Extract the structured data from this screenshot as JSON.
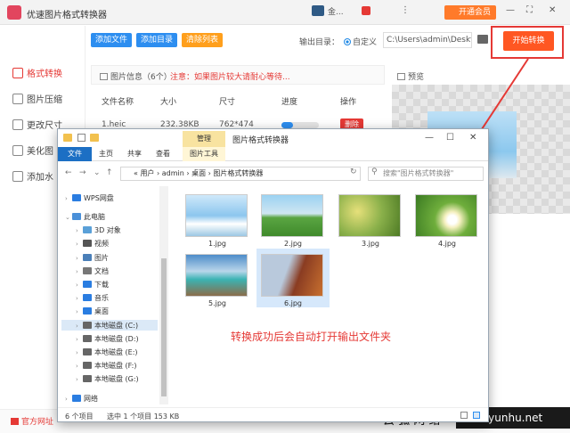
{
  "app": {
    "title": "优速图片格式转换器",
    "user": "金...",
    "vip_label": "开通会员",
    "controls": [
      "⋮",
      "—",
      "⛶",
      "✕"
    ]
  },
  "sidebar": {
    "items": [
      {
        "label": "格式转换",
        "active": true
      },
      {
        "label": "图片压缩"
      },
      {
        "label": "更改尺寸"
      },
      {
        "label": "美化图"
      },
      {
        "label": "添加水"
      }
    ]
  },
  "toolbar": {
    "add_file": "添加文件",
    "add_dir": "添加目录",
    "clear_list": "清除列表",
    "output_label": "输出目录：",
    "radio_label": "自定义",
    "output_path": "C:\\Users\\admin\\Deskto",
    "start_label": "开始转换"
  },
  "file_panel": {
    "info": "图片信息（6个）",
    "warning": "注意：如果图片较大请耐心等待...",
    "columns": [
      "文件名称",
      "大小",
      "尺寸",
      "进度",
      "操作"
    ],
    "row": {
      "name": "1.heic",
      "size": "232.38KB",
      "dims": "762*474",
      "progress": 0.3,
      "delete_label": "删除"
    }
  },
  "preview": {
    "label": "预览"
  },
  "footer": {
    "official": "官方网址",
    "watermark_cn": "云 狐 网 络",
    "watermark_url": "www.yunhu.net"
  },
  "explorer": {
    "title": "图片格式转换器",
    "manage_tab": "管理",
    "tabs": [
      "文件",
      "主页",
      "共享",
      "查看"
    ],
    "picture_tools": "图片工具",
    "address": "« 用户 › admin › 桌面 › 图片格式转换器",
    "search_placeholder": "搜索\"图片格式转换器\"",
    "tree": [
      {
        "label": "WPS网盘",
        "color": "#2a7de1"
      },
      {
        "label": "此电脑",
        "color": "#4a90d9"
      },
      {
        "label": "3D 对象",
        "color": "#5aa0d8"
      },
      {
        "label": "视频",
        "color": "#555"
      },
      {
        "label": "图片",
        "color": "#4a7fb8"
      },
      {
        "label": "文档",
        "color": "#777"
      },
      {
        "label": "下载",
        "color": "#2a7de1"
      },
      {
        "label": "音乐",
        "color": "#2a7de1"
      },
      {
        "label": "桌面",
        "color": "#2a7de1"
      },
      {
        "label": "本地磁盘 (C:)",
        "color": "#666"
      },
      {
        "label": "本地磁盘 (D:)",
        "color": "#666"
      },
      {
        "label": "本地磁盘 (E:)",
        "color": "#666"
      },
      {
        "label": "本地磁盘 (F:)",
        "color": "#666"
      },
      {
        "label": "本地磁盘 (G:)",
        "color": "#666"
      },
      {
        "label": "网络",
        "color": "#2a7de1"
      }
    ],
    "files": [
      "1.jpg",
      "2.jpg",
      "3.jpg",
      "4.jpg",
      "5.jpg",
      "6.jpg"
    ],
    "notice": "转换成功后会自动打开输出文件夹",
    "status_count": "6 个项目",
    "status_selected": "选中 1 个项目  153 KB",
    "controls": [
      "—",
      "☐",
      "✕"
    ]
  }
}
